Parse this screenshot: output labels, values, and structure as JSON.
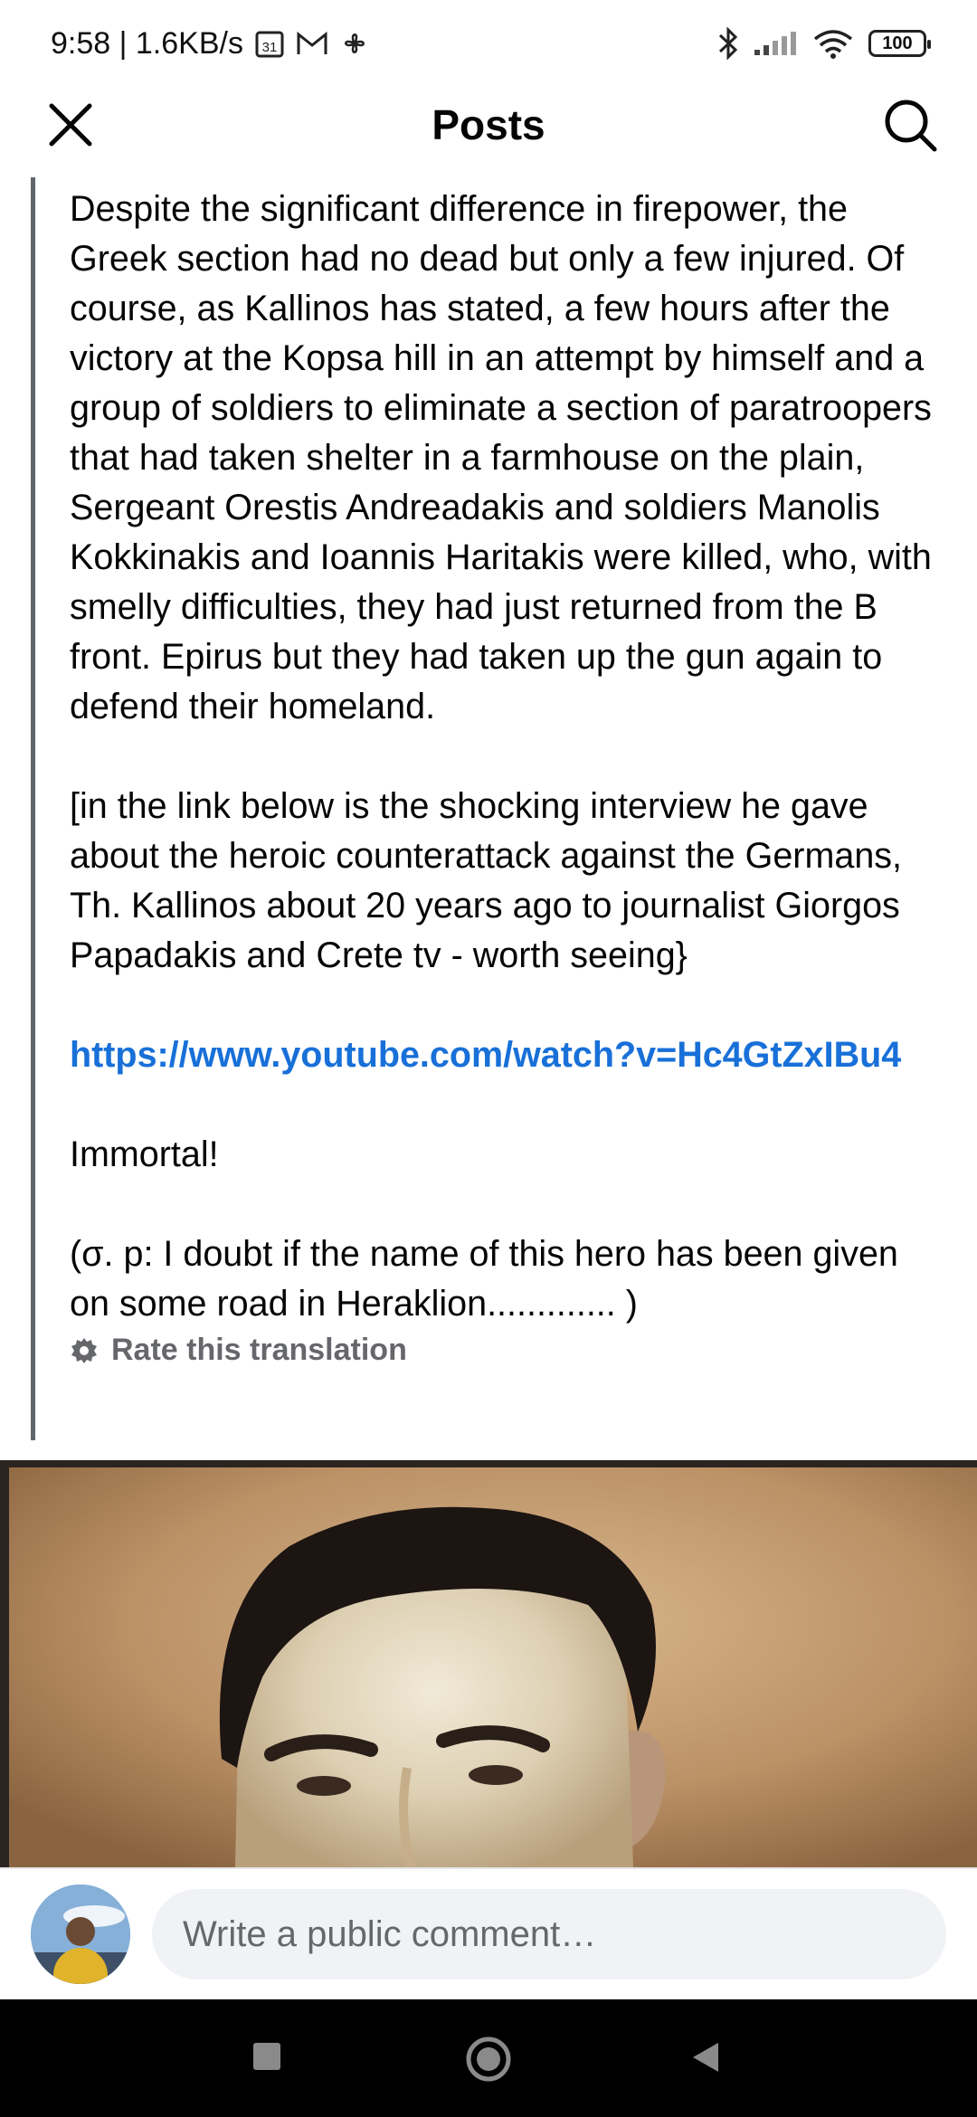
{
  "status_bar": {
    "time": "9:58 | 1.6KB/s",
    "calendar_badge": "31",
    "battery": "100"
  },
  "header": {
    "title": "Posts"
  },
  "post": {
    "paragraph_1": "Despite the significant difference in firepower, the Greek section had no dead but only a few injured. Of course, as Kallinos has stated, a few hours after the victory at the Kopsa hill in an attempt by himself and a group of soldiers to eliminate a section of paratroopers that had taken shelter in a farmhouse on the plain, Sergeant Orestis Andreadakis and soldiers Manolis Kokkinakis and Ioannis Haritakis were killed, who, with smelly difficulties, they had just returned from the B front. Epirus but they had taken up the gun again to defend their homeland.",
    "paragraph_2": "[in the link below is the shocking interview he gave about the heroic counterattack against the Germans, Th. Kallinos about 20 years ago to journalist Giorgos Papadakis and Crete tv - worth seeing}",
    "link": "https://www.youtube.com/watch?v=Hc4GtZxIBu4",
    "paragraph_3": "Immortal!",
    "paragraph_4": "(σ. p: I doubt if the name of this hero has been given on some road in Heraklion............. )",
    "rate_translation": "Rate this translation"
  },
  "comment_bar": {
    "placeholder": "Write a public comment…"
  },
  "colors": {
    "link": "#1870d8",
    "muted": "#65676b",
    "quote_border": "#62666b"
  }
}
